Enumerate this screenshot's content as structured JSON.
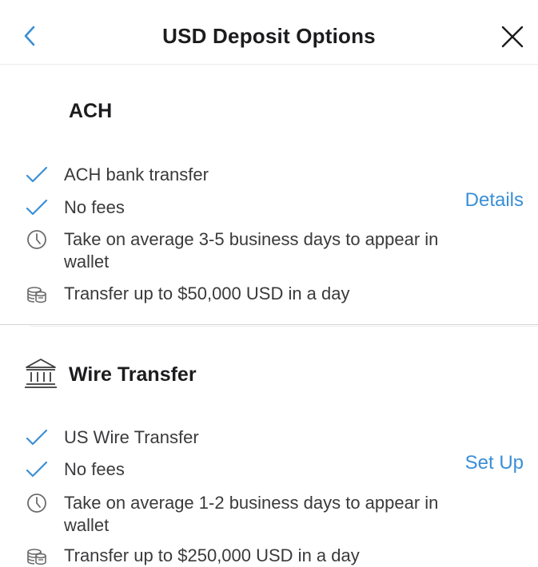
{
  "header": {
    "title": "USD Deposit Options",
    "back_icon": "chevron-left-icon",
    "close_icon": "close-icon"
  },
  "colors": {
    "accent": "#3a8fd6",
    "text": "#1c1c1e",
    "secondary_text": "#3a3a3c"
  },
  "sections": [
    {
      "title": "ACH",
      "icon": null,
      "action_label": "Details",
      "features": [
        {
          "icon": "check-icon",
          "text": "ACH bank transfer"
        },
        {
          "icon": "check-icon",
          "text": "No fees"
        },
        {
          "icon": "clock-icon",
          "text": "Take on average 3-5 business days to appear in wallet"
        },
        {
          "icon": "coins-icon",
          "text": "Transfer up to $50,000 USD in a day"
        }
      ]
    },
    {
      "title": "Wire Transfer",
      "icon": "bank-icon",
      "action_label": "Set Up",
      "features": [
        {
          "icon": "check-icon",
          "text": "US Wire Transfer"
        },
        {
          "icon": "check-icon",
          "text": "No fees"
        },
        {
          "icon": "clock-icon",
          "text": "Take on average 1-2 business days to appear in wallet"
        },
        {
          "icon": "coins-icon",
          "text": "Transfer up to $250,000 USD in a day"
        }
      ]
    }
  ]
}
